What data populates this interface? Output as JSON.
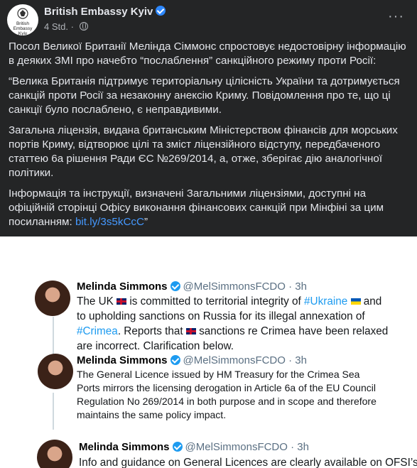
{
  "post": {
    "page_name": "British Embassy Kyiv",
    "avatar_text": "British Embassy Kyiv",
    "time": "4 Std.",
    "more_label": "···",
    "paragraph_1": "Посол Великої Британії Мелінда Сіммонс спростовує недостовірну інформацію в деяких ЗМІ про начебто “послаблення” санкційного режиму проти Росії:",
    "paragraph_2": "“Велика Британія підтримує територіальну цілісність України та дотримується санкцій проти Росії за незаконну анексію Криму.  Повідомлення про те, що ці санкції було послаблено, є неправдивими.",
    "paragraph_3": "Загальна ліцензія, видана британським Міністерством фінансів для морських портів Криму, відтворює цілі та зміст ліцензійного відступу, передбаченого статтею 6а рішення Ради ЄС №269/2014, а, отже, зберігає дію аналогічної політики.",
    "paragraph_4": "Інформація та інструкції, визначені Загальними ліцензіями, доступні на офіційній сторінці Офісу виконання фінансових санкцій при Мінфіні за цим посиланням: ",
    "link_text": "bit.ly/3s5kCcC",
    "closing_quote": "”"
  },
  "tweets": {
    "author": "Melinda Simmons",
    "handle_time": "@MelSimmonsFCDO · 3h",
    "t1": {
      "a": "The UK",
      "b": "is committed to territorial integrity of",
      "tag1": "#Ukraine",
      "c": "and to upholding sanctions on Russia for its illegal annexation of",
      "tag2": "#Crimea",
      "d": ". Reports that",
      "e": "sanctions re Crimea have been relaxed are incorrect. Clarification below."
    },
    "t2": "The General Licence issued by HM Treasury for the Crimea Sea Ports mirrors the licensing derogation in Article 6a of the EU Council Regulation No 269/2014 in both purpose and in scope and therefore maintains the same policy impact.",
    "t3": "Info and guidance on General Licences are clearly available on OFSI’s"
  }
}
